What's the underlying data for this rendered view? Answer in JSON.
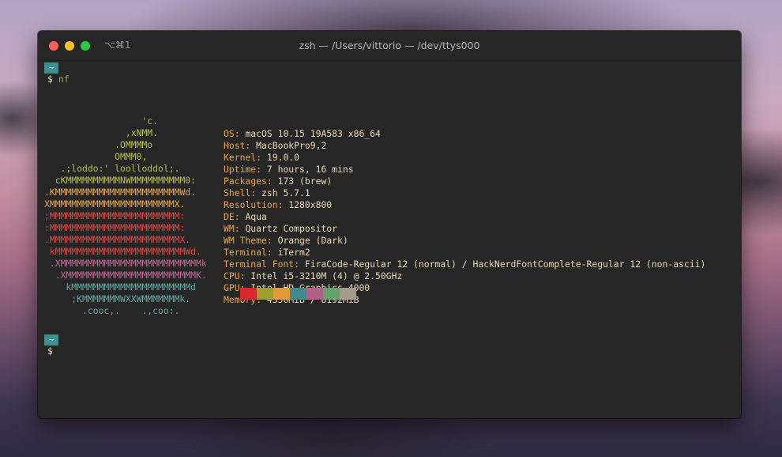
{
  "window": {
    "title": "zsh — /Users/vittorio — /dev/ttys000",
    "shortcut": "⌥⌘1"
  },
  "prompt1": {
    "dir": "~",
    "symbol": "$",
    "command": "nf"
  },
  "prompt2": {
    "dir": "~",
    "symbol": "$"
  },
  "logo": [
    {
      "text": "                  'c.",
      "color": "#b9c14b"
    },
    {
      "text": "               ,xNMM.",
      "color": "#b9c14b"
    },
    {
      "text": "             .OMMMMo",
      "color": "#b9c14b"
    },
    {
      "text": "             OMMM0,",
      "color": "#b9c14b"
    },
    {
      "text": "   .;loddo:' loolloddol;.",
      "color": "#b9c14b"
    },
    {
      "text": "  cKMMMMMMMMMMNWMMMMMMMMMM0:",
      "color": "#b9c14b"
    },
    {
      "text": ".KMMMMMMMMMMMMMMMMMMMMMMMWd.",
      "color": "#e9a84b"
    },
    {
      "text": "XMMMMMMMMMMMMMMMMMMMMMMMX.",
      "color": "#e9a84b"
    },
    {
      "text": ";MMMMMMMMMMMMMMMMMMMMMMMM:",
      "color": "#e04a45"
    },
    {
      "text": ":MMMMMMMMMMMMMMMMMMMMMMMM:",
      "color": "#e04a45"
    },
    {
      "text": ".MMMMMMMMMMMMMMMMMMMMMMMMX.",
      "color": "#e04a45"
    },
    {
      "text": " kMMMMMMMMMMMMMMMMMMMMMMMMWd.",
      "color": "#e04a45"
    },
    {
      "text": " .XMMMMMMMMMMMMMMMMMMMMMMMMMMk",
      "color": "#c06a98"
    },
    {
      "text": "  .XMMMMMMMMMMMMMMMMMMMMMMMMK.",
      "color": "#c06a98"
    },
    {
      "text": "    kMMMMMMMMMMMMMMMMMMMMMMd",
      "color": "#65a8a3"
    },
    {
      "text": "     ;KMMMMMMMWXXWMMMMMMMk.",
      "color": "#65a8a3"
    },
    {
      "text": "       .cooc,.    .,coo:.",
      "color": "#65a8a3"
    }
  ],
  "info": [
    {
      "key": "OS:",
      "value": "macOS 10.15 19A583 x86_64"
    },
    {
      "key": "Host:",
      "value": "MacBookPro9,2"
    },
    {
      "key": "Kernel:",
      "value": "19.0.0"
    },
    {
      "key": "Uptime:",
      "value": "7 hours, 16 mins"
    },
    {
      "key": "Packages:",
      "value": "173 (brew)"
    },
    {
      "key": "Shell:",
      "value": "zsh 5.7.1"
    },
    {
      "key": "Resolution:",
      "value": "1280x800"
    },
    {
      "key": "DE:",
      "value": "Aqua"
    },
    {
      "key": "WM:",
      "value": "Quartz Compositor"
    },
    {
      "key": "WM Theme:",
      "value": "Orange (Dark)"
    },
    {
      "key": "Terminal:",
      "value": "iTerm2"
    },
    {
      "key": "Terminal Font:",
      "value": "FiraCode-Regular 12 (normal) / HackNerdFontComplete-Regular 12 (non-ascii)"
    },
    {
      "key": "CPU:",
      "value": "Intel i5-3210M (4) @ 2.50GHz"
    },
    {
      "key": "GPU:",
      "value": "Intel HD Graphics 4000"
    },
    {
      "key": "Memory:",
      "value": "4350MiB / 8192MiB"
    }
  ],
  "palette": [
    "#d8282e",
    "#9e9e35",
    "#e09a3b",
    "#3f8a8c",
    "#b36089",
    "#66a26e",
    "#a39b8d"
  ]
}
